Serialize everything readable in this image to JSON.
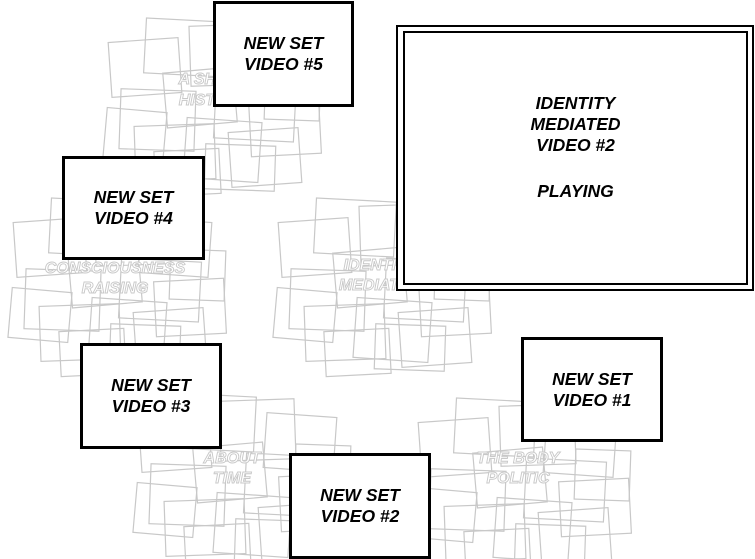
{
  "background_sets": [
    {
      "id": "a-short-history",
      "label_lines": [
        "A SHORT",
        "HISTORY"
      ]
    },
    {
      "id": "consciousness-raising",
      "label_lines": [
        "CONSCIOUSNESS",
        "RAISING"
      ]
    },
    {
      "id": "about-time",
      "label_lines": [
        "ABOUT",
        "TIME"
      ]
    },
    {
      "id": "identity-mediated",
      "label_lines": [
        "IDENTITY",
        "MEDIATED"
      ]
    },
    {
      "id": "the-body-politic",
      "label_lines": [
        "THE BODY",
        "POLITIC"
      ]
    }
  ],
  "videos": [
    {
      "line1": "NEW SET",
      "line2": "VIDEO #5"
    },
    {
      "line1": "NEW SET",
      "line2": "VIDEO #4"
    },
    {
      "line1": "NEW SET",
      "line2": "VIDEO #3"
    },
    {
      "line1": "NEW SET",
      "line2": "VIDEO #2"
    },
    {
      "line1": "NEW SET",
      "line2": "VIDEO #1"
    }
  ],
  "main_video": {
    "title_lines": [
      "IDENTITY",
      "MEDIATED",
      "VIDEO #2"
    ],
    "status": "PLAYING"
  },
  "colors": {
    "ghost_stroke": "#c8c8c8",
    "box_border": "#000000",
    "background": "#ffffff"
  }
}
